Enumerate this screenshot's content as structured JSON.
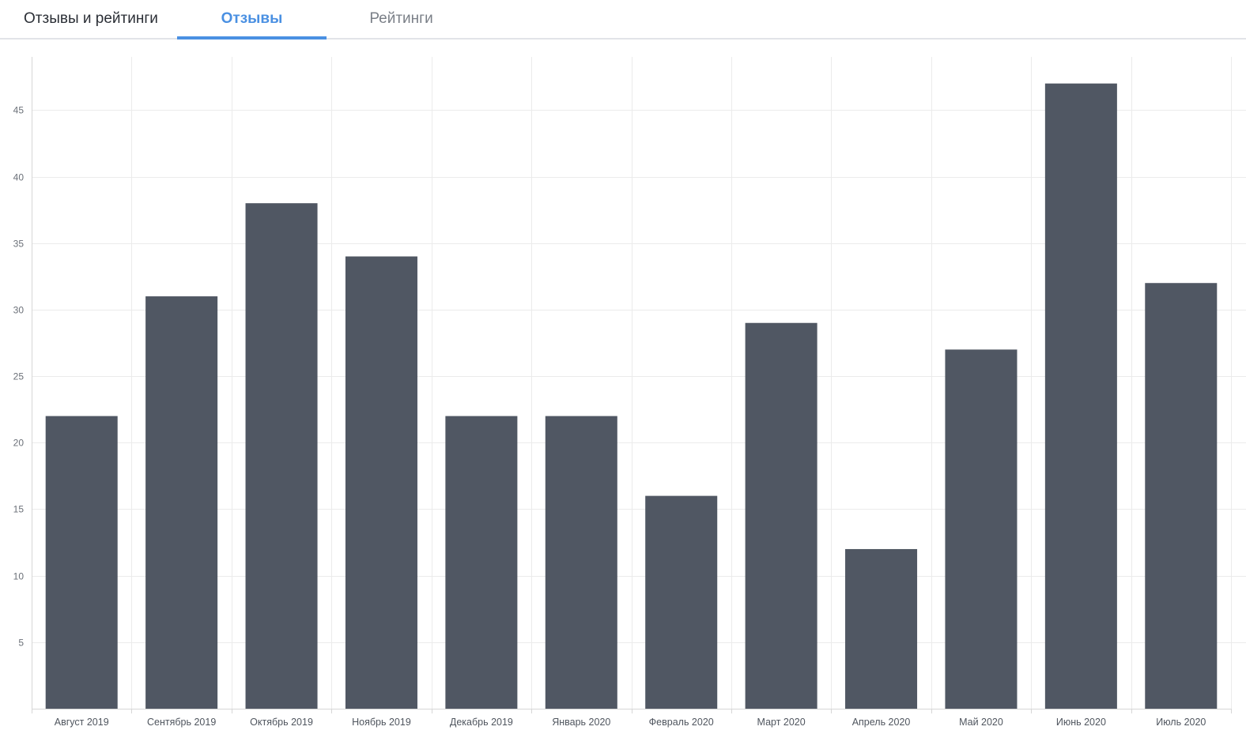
{
  "header": {
    "section_title": "Отзывы и рейтинги",
    "tabs": [
      {
        "label": "Отзывы",
        "active": true
      },
      {
        "label": "Рейтинги",
        "active": false
      }
    ]
  },
  "colors": {
    "accent": "#4a90e2",
    "bar": "#505763",
    "grid": "#ebebeb"
  },
  "chart_data": {
    "type": "bar",
    "categories": [
      "Август 2019",
      "Сентябрь 2019",
      "Октябрь 2019",
      "Ноябрь 2019",
      "Декабрь 2019",
      "Январь 2020",
      "Февраль 2020",
      "Март 2020",
      "Апрель 2020",
      "Май 2020",
      "Июнь 2020",
      "Июль 2020"
    ],
    "values": [
      22,
      31,
      38,
      34,
      22,
      22,
      16,
      29,
      12,
      27,
      47,
      32
    ],
    "ylim": [
      0,
      49
    ],
    "yticks": [
      5,
      10,
      15,
      20,
      25,
      30,
      35,
      40,
      45
    ],
    "grid": true,
    "legend": "none",
    "title": "",
    "xlabel": "",
    "ylabel": ""
  }
}
